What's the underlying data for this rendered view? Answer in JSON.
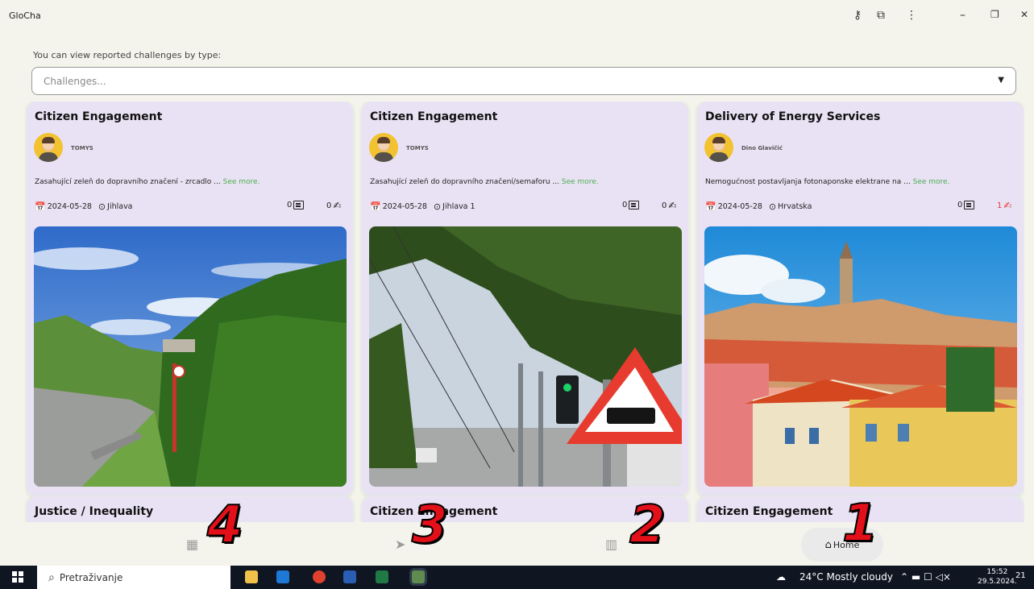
{
  "app": {
    "title": "GloCha"
  },
  "window_controls": {
    "key_icon": "key-icon",
    "extension_icon": "puzzle-icon",
    "menu_icon": "more-vert-icon",
    "minimize": "–",
    "restore": "❐",
    "close": "✕"
  },
  "filter": {
    "label": "You can view reported challenges by type:",
    "placeholder": "Challenges...",
    "chevron": "⌄"
  },
  "cards": [
    {
      "title": "Citizen Engagement",
      "user": "TOMYS",
      "description": "Zasahující zeleň do dopravního značení - zrcadlo ... ",
      "see_more": "See more.",
      "date": "2024-05-28",
      "location": "Jihlava",
      "comments": "0",
      "supports": "0"
    },
    {
      "title": "Citizen Engagement",
      "user": "TOMYS",
      "description": "Zasahující zeleň do dopravního značení/semaforu ... ",
      "see_more": "See more.",
      "date": "2024-05-28",
      "location": "Jihlava 1",
      "comments": "0",
      "supports": "0"
    },
    {
      "title": "Delivery of Energy Services",
      "user": "Dino Glavičić",
      "description": "Nemogućnost postavljanja fotonaponske elektrane na ... ",
      "see_more": "See more.",
      "date": "2024-05-28",
      "location": "Hrvatska",
      "comments": "0",
      "supports": "1"
    },
    {
      "title": "Justice / Inequality"
    },
    {
      "title": "Citizen Engagement"
    },
    {
      "title": "Citizen Engagement"
    }
  ],
  "nav": {
    "home_label": "Home"
  },
  "annotations": [
    "4",
    "3",
    "2",
    "1"
  ],
  "taskbar": {
    "search_placeholder": "Pretraživanje",
    "weather": "24°C  Mostly cloudy",
    "time": "15:52",
    "date": "29.5.2024.",
    "notification_count": "21"
  }
}
